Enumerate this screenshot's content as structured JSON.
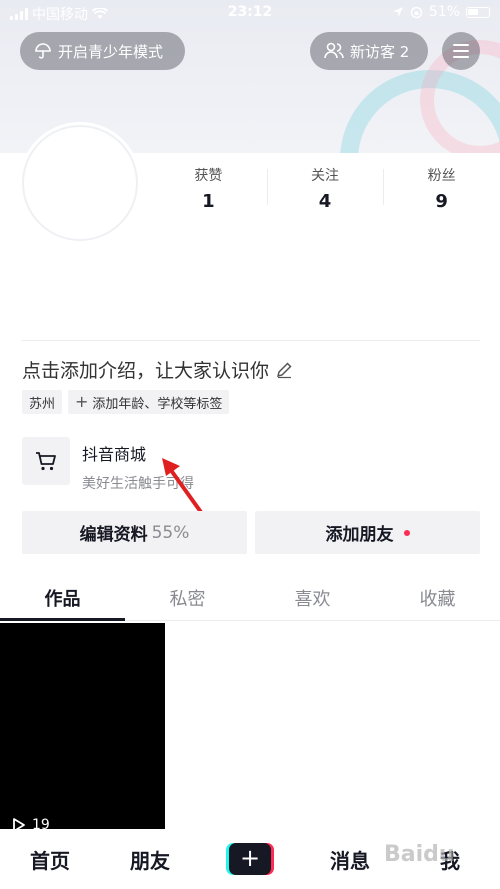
{
  "status_bar": {
    "carrier": "中国移动",
    "time": "23:12",
    "battery": "51%"
  },
  "top": {
    "youth_mode": "开启青少年模式",
    "visitors": "新访客 2"
  },
  "stats": [
    {
      "label": "获赞",
      "value": "1"
    },
    {
      "label": "关注",
      "value": "4"
    },
    {
      "label": "粉丝",
      "value": "9"
    }
  ],
  "intro": "点击添加介绍，让大家认识你",
  "tags": {
    "city": "苏州",
    "add": "添加年龄、学校等标签"
  },
  "shop": {
    "title": "抖音商城",
    "subtitle": "美好生活触手可得"
  },
  "actions": {
    "edit_label": "编辑资料",
    "edit_pct": "55%",
    "add_friend": "添加朋友"
  },
  "tabs": [
    "作品",
    "私密",
    "喜欢",
    "收藏"
  ],
  "video": {
    "plays": "19"
  },
  "nav": {
    "home": "首页",
    "friends": "朋友",
    "messages": "消息",
    "me": "我"
  },
  "watermark": "Baidu",
  "colors": {
    "accent": "#fe2c55",
    "cyan": "#25f4ee",
    "text": "#161823"
  }
}
